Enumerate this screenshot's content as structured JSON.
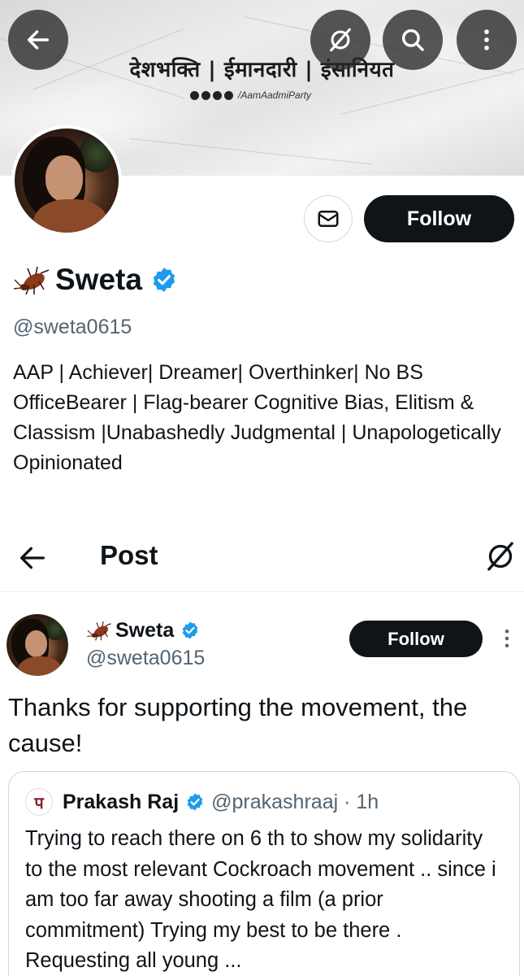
{
  "banner": {
    "title": "देशभक्ति | ईमानदारी | इंसानियत",
    "social_handle": "/AamAadmiParty"
  },
  "top_bar": {
    "back_icon": "arrow-left-icon",
    "grok_icon": "grok-icon",
    "search_icon": "search-icon",
    "more_icon": "more-vertical-icon"
  },
  "profile": {
    "name": "Sweta",
    "handle": "@sweta0615",
    "bio": "AAP | Achiever| Dreamer| Overthinker| No BS OfficeBearer | Flag-bearer Cognitive Bias, Elitism & Classism |Unabashedly Judgmental | Unapologetically Opinionated",
    "follow_label": "Follow",
    "message_icon": "mail-icon",
    "verified_color": "#1d9bf0"
  },
  "post_header": {
    "title": "Post"
  },
  "post": {
    "author_name": "Sweta",
    "author_handle": "@sweta0615",
    "follow_label": "Follow",
    "text": "Thanks for supporting the movement, the cause!"
  },
  "quote": {
    "avatar_letter": "प",
    "author_name": "Prakash Raj",
    "author_handle": "@prakashraaj · 1h",
    "text": "Trying to reach there on 6 th to show my solidarity to the most relevant Cockroach movement  .. since i  am too far away shooting a film (a prior commitment)  Trying my best to be there .  Requesting all young ..."
  }
}
